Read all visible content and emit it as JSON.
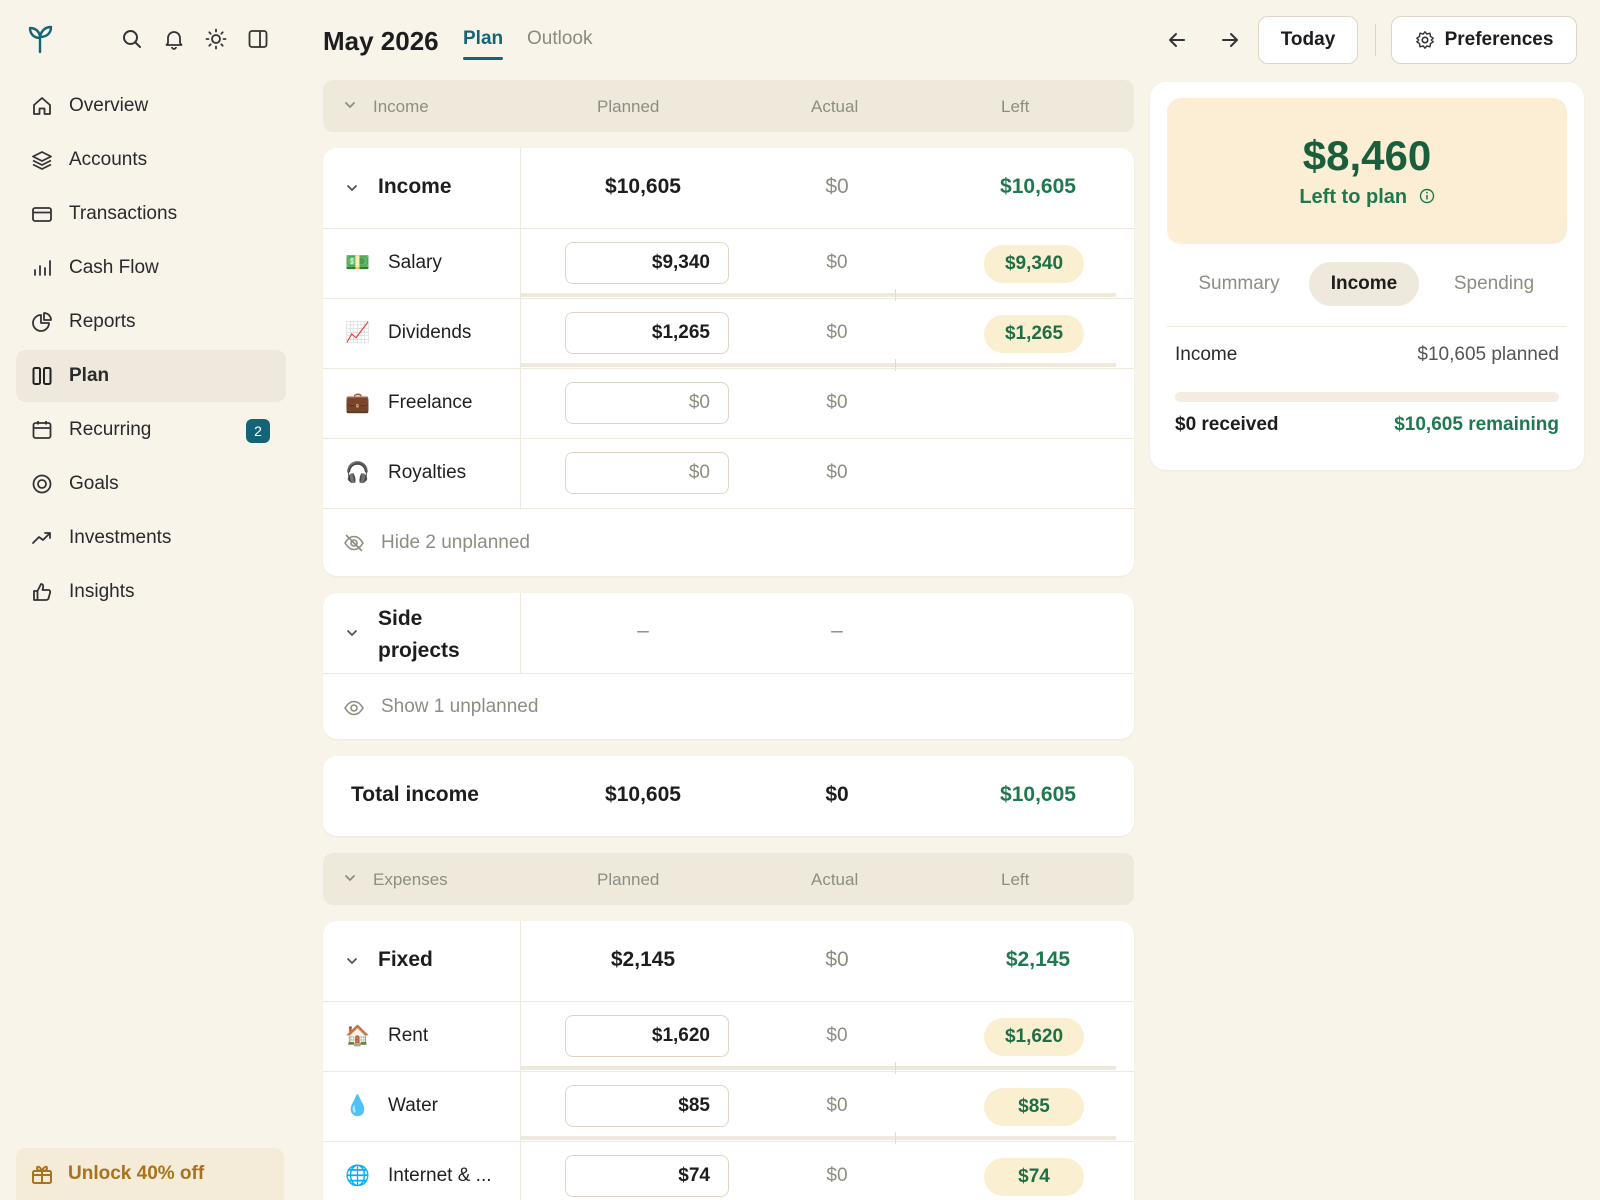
{
  "sidebar": {
    "nav": [
      {
        "label": "Overview",
        "icon": "home-icon"
      },
      {
        "label": "Accounts",
        "icon": "layers-icon"
      },
      {
        "label": "Transactions",
        "icon": "card-icon"
      },
      {
        "label": "Cash Flow",
        "icon": "bar-chart-icon"
      },
      {
        "label": "Reports",
        "icon": "pie-chart-icon"
      },
      {
        "label": "Plan",
        "icon": "columns-icon",
        "active": true
      },
      {
        "label": "Recurring",
        "icon": "calendar-icon",
        "badge": "2"
      },
      {
        "label": "Goals",
        "icon": "target-icon"
      },
      {
        "label": "Investments",
        "icon": "trend-up-icon"
      },
      {
        "label": "Insights",
        "icon": "thumbs-up-icon"
      }
    ],
    "promo": "Unlock 40% off"
  },
  "header": {
    "month": "May 2026",
    "tabs": [
      "Plan",
      "Outlook"
    ],
    "today": "Today",
    "preferences": "Preferences"
  },
  "columns": {
    "planned": "Planned",
    "actual": "Actual",
    "left": "Left"
  },
  "income_section": {
    "title": "Income",
    "groups": [
      {
        "name": "Income",
        "planned": "$10,605",
        "actual": "$0",
        "left": "$10,605",
        "items": [
          {
            "emoji": "💵",
            "name": "Salary",
            "planned": "$9,340",
            "actual": "$0",
            "left": "$9,340"
          },
          {
            "emoji": "📈",
            "name": "Dividends",
            "planned": "$1,265",
            "actual": "$0",
            "left": "$1,265"
          },
          {
            "emoji": "💼",
            "name": "Freelance",
            "planned": "$0",
            "actual": "$0",
            "left": ""
          },
          {
            "emoji": "🎧",
            "name": "Royalties",
            "planned": "$0",
            "actual": "$0",
            "left": ""
          }
        ],
        "footer": "Hide 2 unplanned"
      },
      {
        "name": "Side projects",
        "planned": "–",
        "actual": "–",
        "footer": "Show 1 unplanned"
      }
    ],
    "total": {
      "label": "Total income",
      "planned": "$10,605",
      "actual": "$0",
      "left": "$10,605"
    }
  },
  "expenses_section": {
    "title": "Expenses",
    "groups": [
      {
        "name": "Fixed",
        "planned": "$2,145",
        "actual": "$0",
        "left": "$2,145",
        "items": [
          {
            "emoji": "🏠",
            "name": "Rent",
            "planned": "$1,620",
            "actual": "$0",
            "left": "$1,620"
          },
          {
            "emoji": "💧",
            "name": "Water",
            "planned": "$85",
            "actual": "$0",
            "left": "$85"
          },
          {
            "emoji": "🌐",
            "name": "Internet & ...",
            "planned": "$74",
            "actual": "$0",
            "left": "$74"
          }
        ]
      }
    ]
  },
  "panel": {
    "amount": "$8,460",
    "label": "Left to plan",
    "tabs": [
      "Summary",
      "Income",
      "Spending"
    ],
    "active_tab": "Income",
    "row1_left": "Income",
    "row1_right": "$10,605 planned",
    "progress": 0,
    "row2_left": "$0 received",
    "row2_right": "$10,605 remaining"
  },
  "colors": {
    "accent": "#146477",
    "positive": "#1e7a4e",
    "background": "#f8f4ea",
    "highlight": "#fbeed5"
  }
}
